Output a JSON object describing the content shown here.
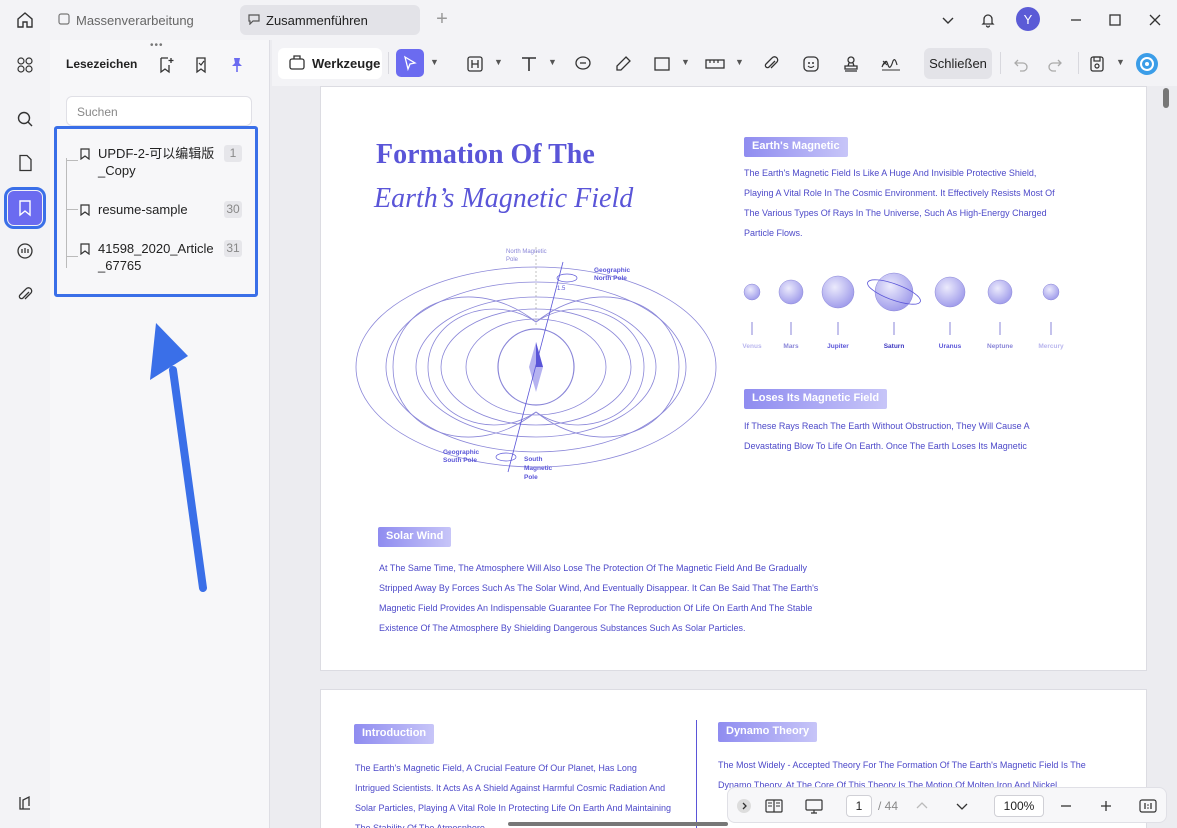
{
  "tabs": [
    {
      "label": "Massenverarbeitung",
      "active": false
    },
    {
      "label": "Zusammenführen",
      "active": true
    }
  ],
  "user": {
    "avatar_letter": "Y"
  },
  "panel": {
    "title": "Lesezeichen",
    "search_placeholder": "Suchen",
    "bookmarks": [
      {
        "label": "UPDF-2-可以编辑版_Copy",
        "page": "1"
      },
      {
        "label": "resume-sample",
        "page": "30"
      },
      {
        "label": "41598_2020_Article_67765",
        "page": "31"
      }
    ]
  },
  "toolbar": {
    "tools_label": "Werkzeuge",
    "close_label": "Schließen"
  },
  "document": {
    "title_line1": "Formation Of The",
    "title_line2": "Earth’s Magnetic Field",
    "section1_title": "Earth's Magnetic",
    "section1_text": "The Earth's Magnetic Field Is Like A Huge And Invisible Protective Shield, Playing A Vital Role In The Cosmic Environment. It Effectively Resists Most Of The Various Types Of Rays In The Universe, Such As High-Energy Charged Particle Flows.",
    "planets": [
      "Venus",
      "Mars",
      "Jupiter",
      "Saturn",
      "Uranus",
      "Neptune",
      "Mercury"
    ],
    "section2_title": "Loses Its Magnetic Field",
    "section2_text": "If These Rays Reach The Earth Without Obstruction, They Will Cause A Devastating Blow To Life On Earth. Once The Earth Loses Its Magnetic",
    "section3_title": "Solar Wind",
    "section3_text": "At The Same Time, The Atmosphere Will Also Lose The Protection Of The Magnetic Field And Be Gradually Stripped Away By Forces Such As The Solar Wind, And Eventually Disappear. It Can Be Said That The Earth's Magnetic Field Provides An Indispensable Guarantee For The Reproduction Of Life On Earth And The Stable Existence Of The Atmosphere By Shielding Dangerous Substances Such As Solar Particles.",
    "diagram_labels": {
      "north_magnetic": "North Magnetic Pole",
      "geo_north": "Geographic North Pole",
      "angle": "1.5",
      "geo_south": "Geographic South Pole",
      "south_magnetic": "South Magnetic Pole"
    },
    "page2_left_title": "Introduction",
    "page2_left_text": "The Earth's Magnetic Field, A Crucial Feature Of Our Planet, Has Long Intrigued Scientists. It Acts As A Shield Against Harmful Cosmic Radiation And Solar Particles, Playing A Vital Role In Protecting Life On Earth And Maintaining The Stability Of The Atmosphere",
    "page2_right_title": "Dynamo Theory",
    "page2_right_text": "The Most Widely - Accepted Theory For The Formation Of The Earth's Magnetic Field Is The Dynamo Theory. At The Core Of This Theory Is The Motion Of Molten Iron And Nickel"
  },
  "pager": {
    "current_page": "1",
    "total_pages": "/ 44",
    "zoom": "100%"
  }
}
